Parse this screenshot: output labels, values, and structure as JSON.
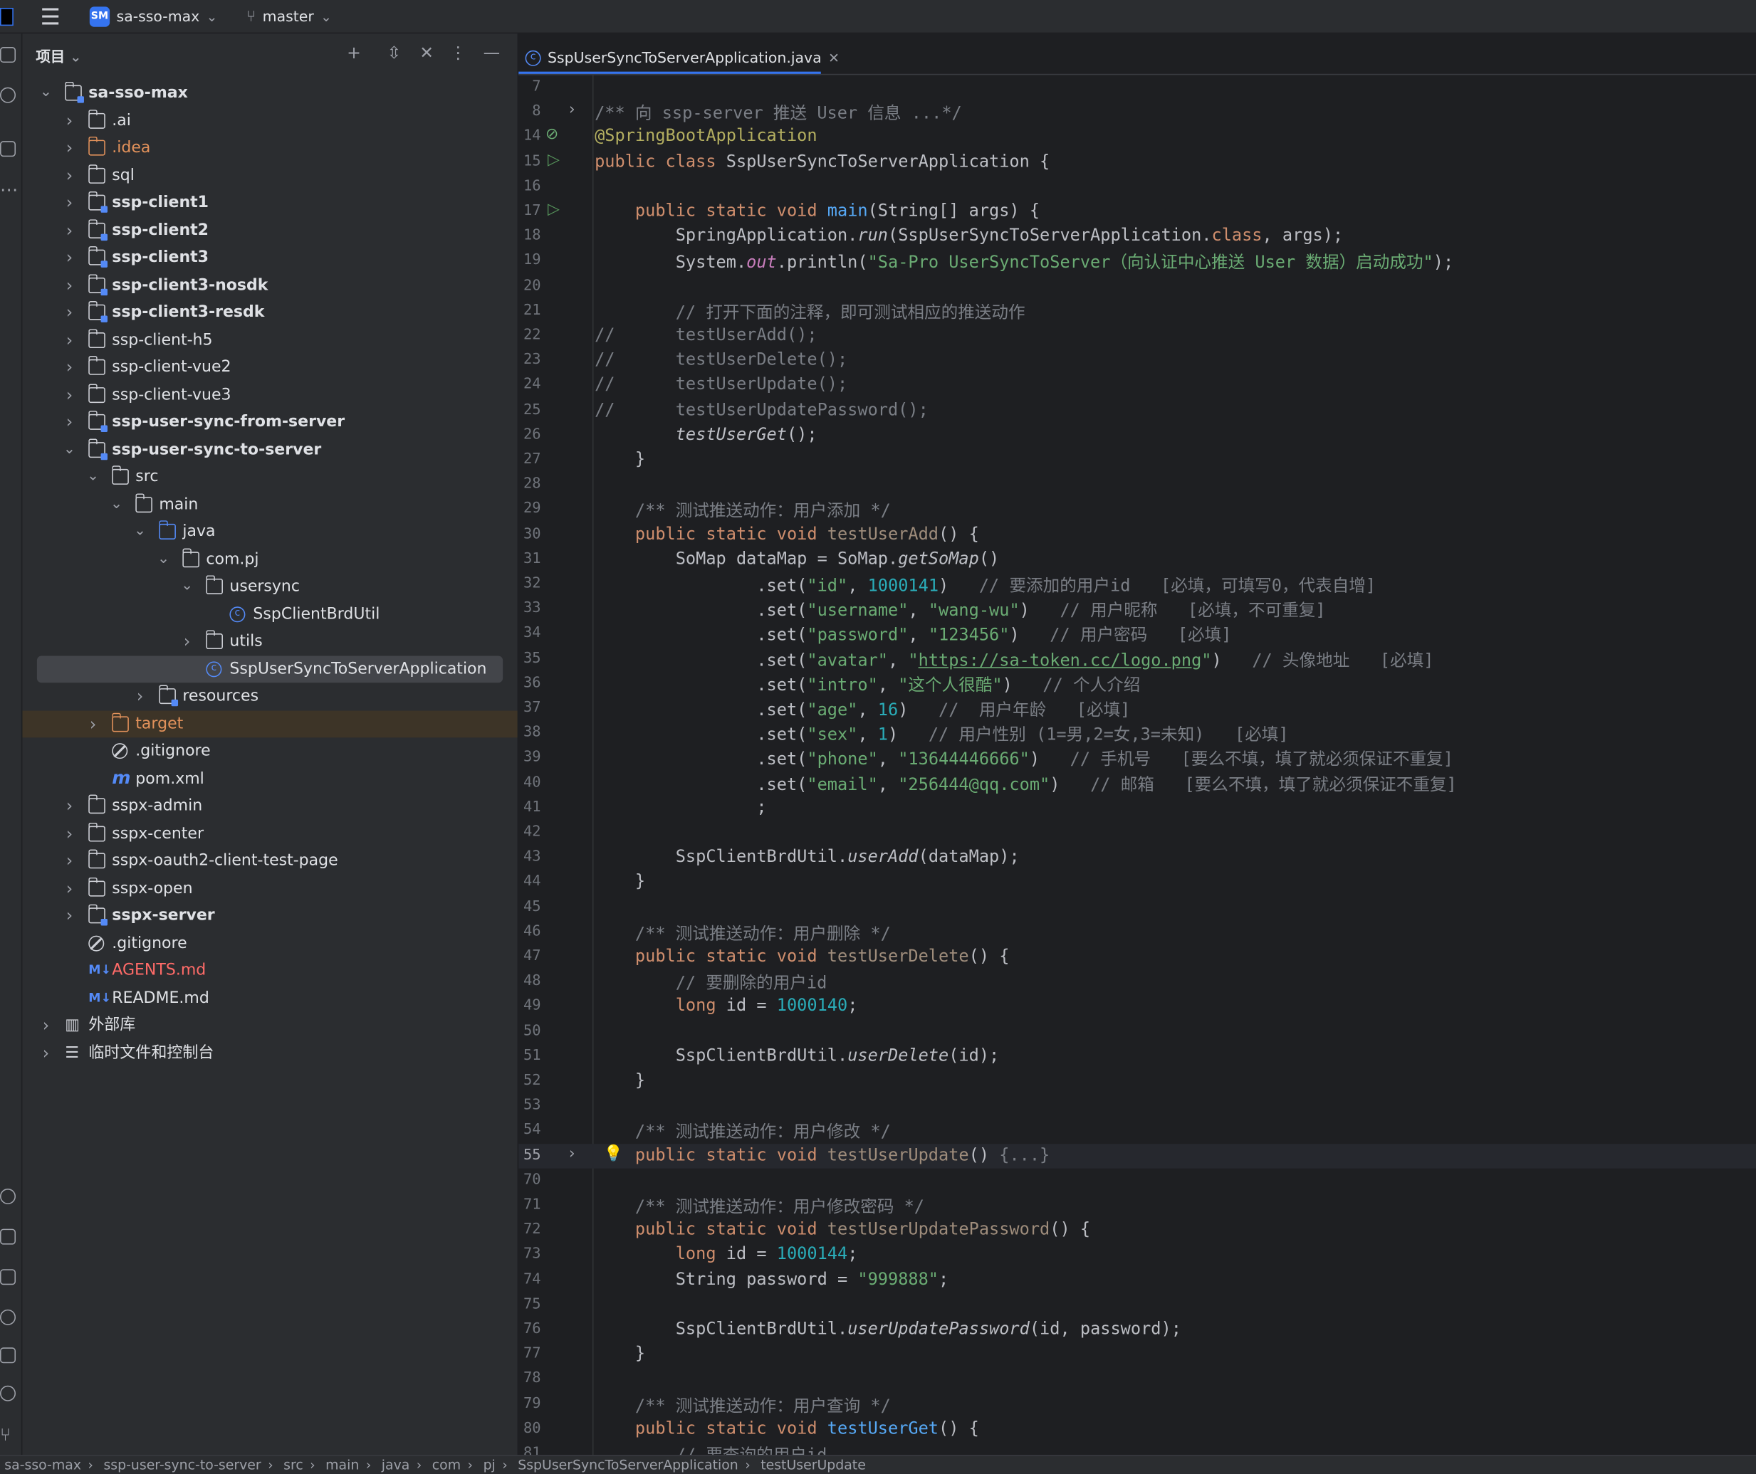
{
  "titlebar": {
    "project_badge": "SM",
    "project_name": "sa-sso-max",
    "branch": "master"
  },
  "project_panel": {
    "title": "项目",
    "tree": [
      {
        "label": "sa-sso-max",
        "depth": 0,
        "expanded": true,
        "icon": "module-folder-icon",
        "bold": true
      },
      {
        "label": ".ai",
        "depth": 1,
        "expanded": false,
        "icon": "folder-icon"
      },
      {
        "label": ".idea",
        "depth": 1,
        "expanded": false,
        "icon": "folder-icon",
        "color": "orange"
      },
      {
        "label": "sql",
        "depth": 1,
        "expanded": false,
        "icon": "folder-icon"
      },
      {
        "label": "ssp-client1",
        "depth": 1,
        "expanded": false,
        "icon": "module-folder-icon",
        "bold": true
      },
      {
        "label": "ssp-client2",
        "depth": 1,
        "expanded": false,
        "icon": "module-folder-icon",
        "bold": true
      },
      {
        "label": "ssp-client3",
        "depth": 1,
        "expanded": false,
        "icon": "module-folder-icon",
        "bold": true
      },
      {
        "label": "ssp-client3-nosdk",
        "depth": 1,
        "expanded": false,
        "icon": "module-folder-icon",
        "bold": true
      },
      {
        "label": "ssp-client3-resdk",
        "depth": 1,
        "expanded": false,
        "icon": "module-folder-icon",
        "bold": true
      },
      {
        "label": "ssp-client-h5",
        "depth": 1,
        "expanded": false,
        "icon": "folder-icon"
      },
      {
        "label": "ssp-client-vue2",
        "depth": 1,
        "expanded": false,
        "icon": "folder-icon"
      },
      {
        "label": "ssp-client-vue3",
        "depth": 1,
        "expanded": false,
        "icon": "folder-icon"
      },
      {
        "label": "ssp-user-sync-from-server",
        "depth": 1,
        "expanded": false,
        "icon": "module-folder-icon",
        "bold": true
      },
      {
        "label": "ssp-user-sync-to-server",
        "depth": 1,
        "expanded": true,
        "icon": "module-folder-icon",
        "bold": true
      },
      {
        "label": "src",
        "depth": 2,
        "expanded": true,
        "icon": "folder-icon"
      },
      {
        "label": "main",
        "depth": 3,
        "expanded": true,
        "icon": "folder-icon"
      },
      {
        "label": "java",
        "depth": 4,
        "expanded": true,
        "icon": "source-folder-icon"
      },
      {
        "label": "com.pj",
        "depth": 5,
        "expanded": true,
        "icon": "package-icon"
      },
      {
        "label": "usersync",
        "depth": 6,
        "expanded": true,
        "icon": "package-icon"
      },
      {
        "label": "SspClientBrdUtil",
        "depth": 7,
        "expanded": null,
        "icon": "class-icon"
      },
      {
        "label": "utils",
        "depth": 6,
        "expanded": false,
        "icon": "package-icon"
      },
      {
        "label": "SspUserSyncToServerApplication",
        "depth": 6,
        "expanded": null,
        "icon": "spring-class-icon",
        "selected": true
      },
      {
        "label": "resources",
        "depth": 4,
        "expanded": false,
        "icon": "resources-folder-icon"
      },
      {
        "label": "target",
        "depth": 2,
        "expanded": false,
        "icon": "folder-icon",
        "color": "orange",
        "highlight": true
      },
      {
        "label": ".gitignore",
        "depth": 2,
        "expanded": null,
        "icon": "gitignore-icon"
      },
      {
        "label": "pom.xml",
        "depth": 2,
        "expanded": null,
        "icon": "maven-icon"
      },
      {
        "label": "sspx-admin",
        "depth": 1,
        "expanded": false,
        "icon": "folder-icon"
      },
      {
        "label": "sspx-center",
        "depth": 1,
        "expanded": false,
        "icon": "folder-icon"
      },
      {
        "label": "sspx-oauth2-client-test-page",
        "depth": 1,
        "expanded": false,
        "icon": "folder-icon"
      },
      {
        "label": "sspx-open",
        "depth": 1,
        "expanded": false,
        "icon": "folder-icon"
      },
      {
        "label": "sspx-server",
        "depth": 1,
        "expanded": false,
        "icon": "module-folder-icon",
        "bold": true
      },
      {
        "label": ".gitignore",
        "depth": 1,
        "expanded": null,
        "icon": "gitignore-icon"
      },
      {
        "label": "AGENTS.md",
        "depth": 1,
        "expanded": null,
        "icon": "markdown-icon",
        "color": "red"
      },
      {
        "label": "README.md",
        "depth": 1,
        "expanded": null,
        "icon": "markdown-icon"
      },
      {
        "label": "外部库",
        "depth": 0,
        "expanded": false,
        "icon": "library-icon"
      },
      {
        "label": "临时文件和控制台",
        "depth": 0,
        "expanded": false,
        "icon": "scratches-icon"
      }
    ]
  },
  "editor": {
    "tab_label": "SspUserSyncToServerApplication.java",
    "current_line": "55",
    "lines": [
      {
        "n": "7",
        "tokens": []
      },
      {
        "n": "8",
        "fold": true,
        "tokens": [
          [
            "c",
            "/** 向 ssp-server 推送 User 信息 ...*/"
          ]
        ]
      },
      {
        "n": "14",
        "gutter": "spring",
        "tokens": [
          [
            "an",
            "@SpringBootApplication"
          ]
        ]
      },
      {
        "n": "15",
        "gutter": "run",
        "tokens": [
          [
            "k",
            "public class "
          ],
          [
            "",
            "SspUserSyncToServerApplication {"
          ]
        ]
      },
      {
        "n": "16",
        "tokens": []
      },
      {
        "n": "17",
        "gutter": "run",
        "tokens": [
          [
            "",
            "    "
          ],
          [
            "k",
            "public static void "
          ],
          [
            "fn",
            "main"
          ],
          [
            "",
            "(String[] args) {"
          ]
        ]
      },
      {
        "n": "18",
        "tokens": [
          [
            "",
            "        SpringApplication."
          ],
          [
            "it",
            "run"
          ],
          [
            "",
            "(SspUserSyncToServerApplication."
          ],
          [
            "k",
            "class"
          ],
          [
            "",
            ", args);"
          ]
        ]
      },
      {
        "n": "19",
        "tokens": [
          [
            "",
            "        System."
          ],
          [
            "f it",
            "out"
          ],
          [
            "",
            ".println("
          ],
          [
            "s",
            "\"Sa-Pro UserSyncToServer（向认证中心推送 User 数据）启动成功\""
          ],
          [
            "",
            ");"
          ]
        ]
      },
      {
        "n": "20",
        "tokens": []
      },
      {
        "n": "21",
        "tokens": [
          [
            "c",
            "        // 打开下面的注释，即可测试相应的推送动作"
          ]
        ]
      },
      {
        "n": "22",
        "tokens": [
          [
            "c",
            "//      testUserAdd();"
          ]
        ]
      },
      {
        "n": "23",
        "tokens": [
          [
            "c",
            "//      testUserDelete();"
          ]
        ]
      },
      {
        "n": "24",
        "tokens": [
          [
            "c",
            "//      testUserUpdate();"
          ]
        ]
      },
      {
        "n": "25",
        "tokens": [
          [
            "c",
            "//      testUserUpdatePassword();"
          ]
        ]
      },
      {
        "n": "26",
        "tokens": [
          [
            "",
            "        "
          ],
          [
            "it",
            "testUserGet"
          ],
          [
            "",
            "();"
          ]
        ]
      },
      {
        "n": "27",
        "tokens": [
          [
            "",
            "    }"
          ]
        ]
      },
      {
        "n": "28",
        "tokens": []
      },
      {
        "n": "29",
        "tokens": [
          [
            "",
            "    "
          ],
          [
            "c",
            "/** 测试推送动作：用户添加 */"
          ]
        ]
      },
      {
        "n": "30",
        "tokens": [
          [
            "",
            "    "
          ],
          [
            "k",
            "public static void "
          ],
          [
            "gr",
            "testUserAdd"
          ],
          [
            "",
            "() {"
          ]
        ]
      },
      {
        "n": "31",
        "tokens": [
          [
            "",
            "        SoMap dataMap = SoMap."
          ],
          [
            "it",
            "getSoMap"
          ],
          [
            "",
            "()"
          ]
        ]
      },
      {
        "n": "32",
        "tokens": [
          [
            "",
            "                .set("
          ],
          [
            "s",
            "\"id\""
          ],
          [
            "",
            ", "
          ],
          [
            "n",
            "1000141"
          ],
          [
            "",
            ")   "
          ],
          [
            "c",
            "// 要添加的用户id   [必填，可填写0，代表自增]"
          ]
        ]
      },
      {
        "n": "33",
        "tokens": [
          [
            "",
            "                .set("
          ],
          [
            "s",
            "\"username\""
          ],
          [
            "",
            ", "
          ],
          [
            "s",
            "\"wang-wu\""
          ],
          [
            "",
            ")   "
          ],
          [
            "c",
            "// 用户昵称   [必填，不可重复]"
          ]
        ]
      },
      {
        "n": "34",
        "tokens": [
          [
            "",
            "                .set("
          ],
          [
            "s",
            "\"password\""
          ],
          [
            "",
            ", "
          ],
          [
            "s",
            "\"123456\""
          ],
          [
            "",
            ")   "
          ],
          [
            "c",
            "// 用户密码   [必填]"
          ]
        ]
      },
      {
        "n": "35",
        "tokens": [
          [
            "",
            "                .set("
          ],
          [
            "s",
            "\"avatar\""
          ],
          [
            "",
            ", "
          ],
          [
            "s",
            "\""
          ],
          [
            "link",
            "https://sa-token.cc/logo.png"
          ],
          [
            "s",
            "\""
          ],
          [
            "",
            ")   "
          ],
          [
            "c",
            "// 头像地址   [必填]"
          ]
        ]
      },
      {
        "n": "36",
        "tokens": [
          [
            "",
            "                .set("
          ],
          [
            "s",
            "\"intro\""
          ],
          [
            "",
            ", "
          ],
          [
            "s",
            "\"这个人很酷\""
          ],
          [
            "",
            ")   "
          ],
          [
            "c",
            "// 个人介绍"
          ]
        ]
      },
      {
        "n": "37",
        "tokens": [
          [
            "",
            "                .set("
          ],
          [
            "s",
            "\"age\""
          ],
          [
            "",
            ", "
          ],
          [
            "n",
            "16"
          ],
          [
            "",
            ")   "
          ],
          [
            "c",
            "//  用户年龄   [必填]"
          ]
        ]
      },
      {
        "n": "38",
        "tokens": [
          [
            "",
            "                .set("
          ],
          [
            "s",
            "\"sex\""
          ],
          [
            "",
            ", "
          ],
          [
            "n",
            "1"
          ],
          [
            "",
            ")   "
          ],
          [
            "c",
            "// 用户性别 (1=男,2=女,3=未知)   [必填]"
          ]
        ]
      },
      {
        "n": "39",
        "tokens": [
          [
            "",
            "                .set("
          ],
          [
            "s",
            "\"phone\""
          ],
          [
            "",
            ", "
          ],
          [
            "s",
            "\"13644446666\""
          ],
          [
            "",
            ")   "
          ],
          [
            "c",
            "// 手机号   [要么不填，填了就必须保证不重复]"
          ]
        ]
      },
      {
        "n": "40",
        "tokens": [
          [
            "",
            "                .set("
          ],
          [
            "s",
            "\"email\""
          ],
          [
            "",
            ", "
          ],
          [
            "s",
            "\"256444@qq.com\""
          ],
          [
            "",
            ")   "
          ],
          [
            "c",
            "// 邮箱   [要么不填，填了就必须保证不重复]"
          ]
        ]
      },
      {
        "n": "41",
        "tokens": [
          [
            "",
            "                ;"
          ]
        ]
      },
      {
        "n": "42",
        "tokens": []
      },
      {
        "n": "43",
        "tokens": [
          [
            "",
            "        SspClientBrdUtil."
          ],
          [
            "it",
            "userAdd"
          ],
          [
            "",
            "(dataMap);"
          ]
        ]
      },
      {
        "n": "44",
        "tokens": [
          [
            "",
            "    }"
          ]
        ]
      },
      {
        "n": "45",
        "tokens": []
      },
      {
        "n": "46",
        "tokens": [
          [
            "",
            "    "
          ],
          [
            "c",
            "/** 测试推送动作：用户删除 */"
          ]
        ]
      },
      {
        "n": "47",
        "tokens": [
          [
            "",
            "    "
          ],
          [
            "k",
            "public static void "
          ],
          [
            "gr",
            "testUserDelete"
          ],
          [
            "",
            "() {"
          ]
        ]
      },
      {
        "n": "48",
        "tokens": [
          [
            "c",
            "        // 要删除的用户id"
          ]
        ]
      },
      {
        "n": "49",
        "tokens": [
          [
            "",
            "        "
          ],
          [
            "k",
            "long "
          ],
          [
            "",
            "id = "
          ],
          [
            "n",
            "1000140"
          ],
          [
            "",
            ";"
          ]
        ]
      },
      {
        "n": "50",
        "tokens": []
      },
      {
        "n": "51",
        "tokens": [
          [
            "",
            "        SspClientBrdUtil."
          ],
          [
            "it",
            "userDelete"
          ],
          [
            "",
            "(id);"
          ]
        ]
      },
      {
        "n": "52",
        "tokens": [
          [
            "",
            "    }"
          ]
        ]
      },
      {
        "n": "53",
        "tokens": []
      },
      {
        "n": "54",
        "tokens": [
          [
            "",
            "    "
          ],
          [
            "c",
            "/** 测试推送动作：用户修改 */"
          ]
        ]
      },
      {
        "n": "55",
        "fold": true,
        "gutter": "bulb",
        "current": true,
        "tokens": [
          [
            "",
            "    "
          ],
          [
            "k",
            "public static void "
          ],
          [
            "gr",
            "testUserUpdate"
          ],
          [
            "",
            "() "
          ],
          [
            "c",
            "{...}"
          ]
        ]
      },
      {
        "n": "70",
        "tokens": []
      },
      {
        "n": "71",
        "tokens": [
          [
            "",
            "    "
          ],
          [
            "c",
            "/** 测试推送动作：用户修改密码 */"
          ]
        ]
      },
      {
        "n": "72",
        "tokens": [
          [
            "",
            "    "
          ],
          [
            "k",
            "public static void "
          ],
          [
            "gr",
            "testUserUpdatePassword"
          ],
          [
            "",
            "() {"
          ]
        ]
      },
      {
        "n": "73",
        "tokens": [
          [
            "",
            "        "
          ],
          [
            "k",
            "long "
          ],
          [
            "",
            "id = "
          ],
          [
            "n",
            "1000144"
          ],
          [
            "",
            ";"
          ]
        ]
      },
      {
        "n": "74",
        "tokens": [
          [
            "",
            "        String password = "
          ],
          [
            "s",
            "\"999888\""
          ],
          [
            "",
            ";"
          ]
        ]
      },
      {
        "n": "75",
        "tokens": []
      },
      {
        "n": "76",
        "tokens": [
          [
            "",
            "        SspClientBrdUtil."
          ],
          [
            "it",
            "userUpdatePassword"
          ],
          [
            "",
            "(id, password);"
          ]
        ]
      },
      {
        "n": "77",
        "tokens": [
          [
            "",
            "    }"
          ]
        ]
      },
      {
        "n": "78",
        "tokens": []
      },
      {
        "n": "79",
        "tokens": [
          [
            "",
            "    "
          ],
          [
            "c",
            "/** 测试推送动作：用户查询 */"
          ]
        ]
      },
      {
        "n": "80",
        "tokens": [
          [
            "",
            "    "
          ],
          [
            "k",
            "public static void "
          ],
          [
            "fn",
            "testUserGet"
          ],
          [
            "",
            "() {"
          ]
        ]
      },
      {
        "n": "81",
        "tokens": [
          [
            "c",
            "        // 要查询的用户id"
          ]
        ]
      }
    ]
  },
  "statusbar": {
    "breadcrumbs": [
      "sa-sso-max",
      "ssp-user-sync-to-server",
      "src",
      "main",
      "java",
      "com",
      "pj",
      "SspUserSyncToServerApplication",
      "testUserUpdate"
    ]
  }
}
